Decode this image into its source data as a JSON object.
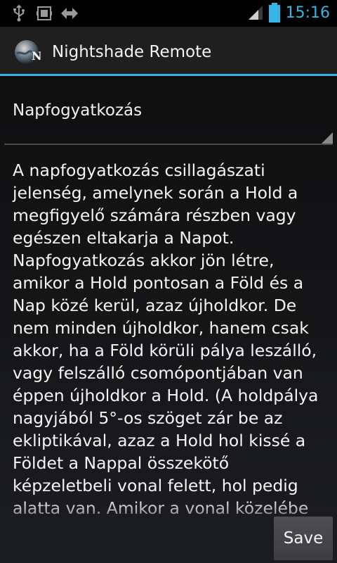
{
  "status_bar": {
    "time": "15:16",
    "icons": [
      "usb-icon",
      "sd-card-icon",
      "debug-arrows-icon",
      "signal-icon",
      "battery-icon"
    ],
    "accent_color": "#33b5e5"
  },
  "action_bar": {
    "app_icon": "nightshade-logo-icon",
    "title": "Nightshade Remote"
  },
  "selector": {
    "selected": "Napfogyatkozás"
  },
  "description": {
    "text": "A napfogyatkozás csillagászati\njelenség, amelynek során a Hold a\nmegfigyelő számára részben vagy\negészen eltakarja a Napot.\nNapfogyatkozás akkor jön létre,\namikor a Hold pontosan a Föld és a\nNap közé kerül, azaz újholdkor. De\nnem minden újholdkor, hanem csak\nakkor, ha a Föld körüli pálya leszálló,\nvagy felszálló csomópontjában van\néppen újholdkor a Hold. (A holdpálya\nnagyjából 5°-os szöget zár be az\nekliptikával, azaz a Hold hol kissé a\nFöldet a Nappal összekötő\nképzeletbeli vonal felett, hol pedig\nalatta van. Amikor a vonal közelébe"
  },
  "buttons": {
    "save_label": "Save"
  }
}
